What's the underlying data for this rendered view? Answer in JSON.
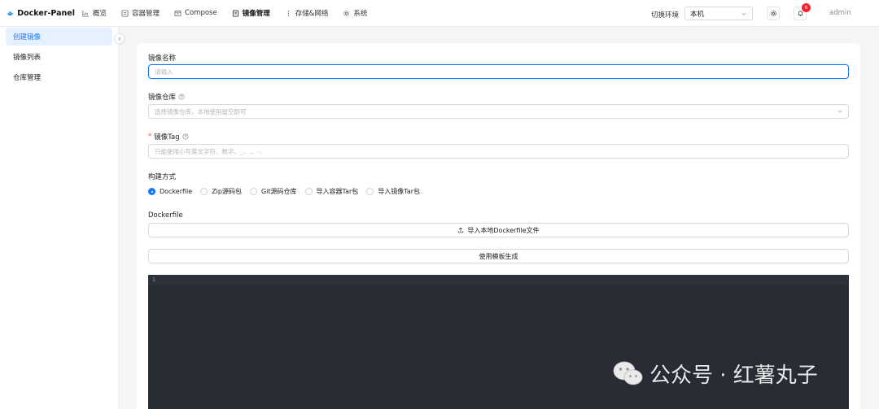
{
  "app": {
    "name": "Docker-Panel",
    "accent": "#1677ff"
  },
  "nav": [
    {
      "label": "概览",
      "icon": "chart-icon"
    },
    {
      "label": "容器管理",
      "icon": "container-icon"
    },
    {
      "label": "Compose",
      "icon": "compose-icon"
    },
    {
      "label": "镜像管理",
      "icon": "image-icon",
      "active": true
    },
    {
      "label": "存储&网络",
      "icon": "storage-icon"
    },
    {
      "label": "系统",
      "icon": "gear-icon"
    }
  ],
  "header": {
    "env_label": "切换环境",
    "env_value": "本机",
    "notification_count": "6",
    "user": "admin"
  },
  "sidebar": {
    "items": [
      {
        "label": "创建镜像",
        "active": true
      },
      {
        "label": "镜像列表"
      },
      {
        "label": "仓库管理"
      }
    ]
  },
  "form": {
    "name_label": "镜像名称",
    "name_placeholder": "请输入",
    "repo_label": "镜像仓库",
    "repo_placeholder": "选择镜像仓库，本地使用留空即可",
    "tag_label": "镜像Tag",
    "tag_placeholder": "只能使用小写英文字符、数字、_、.、-、",
    "build_label": "构建方式",
    "build_options": [
      "Dockerfile",
      "Zip源码包",
      "Git源码仓库",
      "导入容器Tar包",
      "导入镜像Tar包"
    ],
    "build_selected": "Dockerfile",
    "dockerfile_label": "Dockerfile",
    "import_button": "导入本地Dockerfile文件",
    "template_button": "使用模板生成",
    "editor_line_number": "1"
  },
  "watermark": {
    "text": "公众号 · 红薯丸子"
  }
}
